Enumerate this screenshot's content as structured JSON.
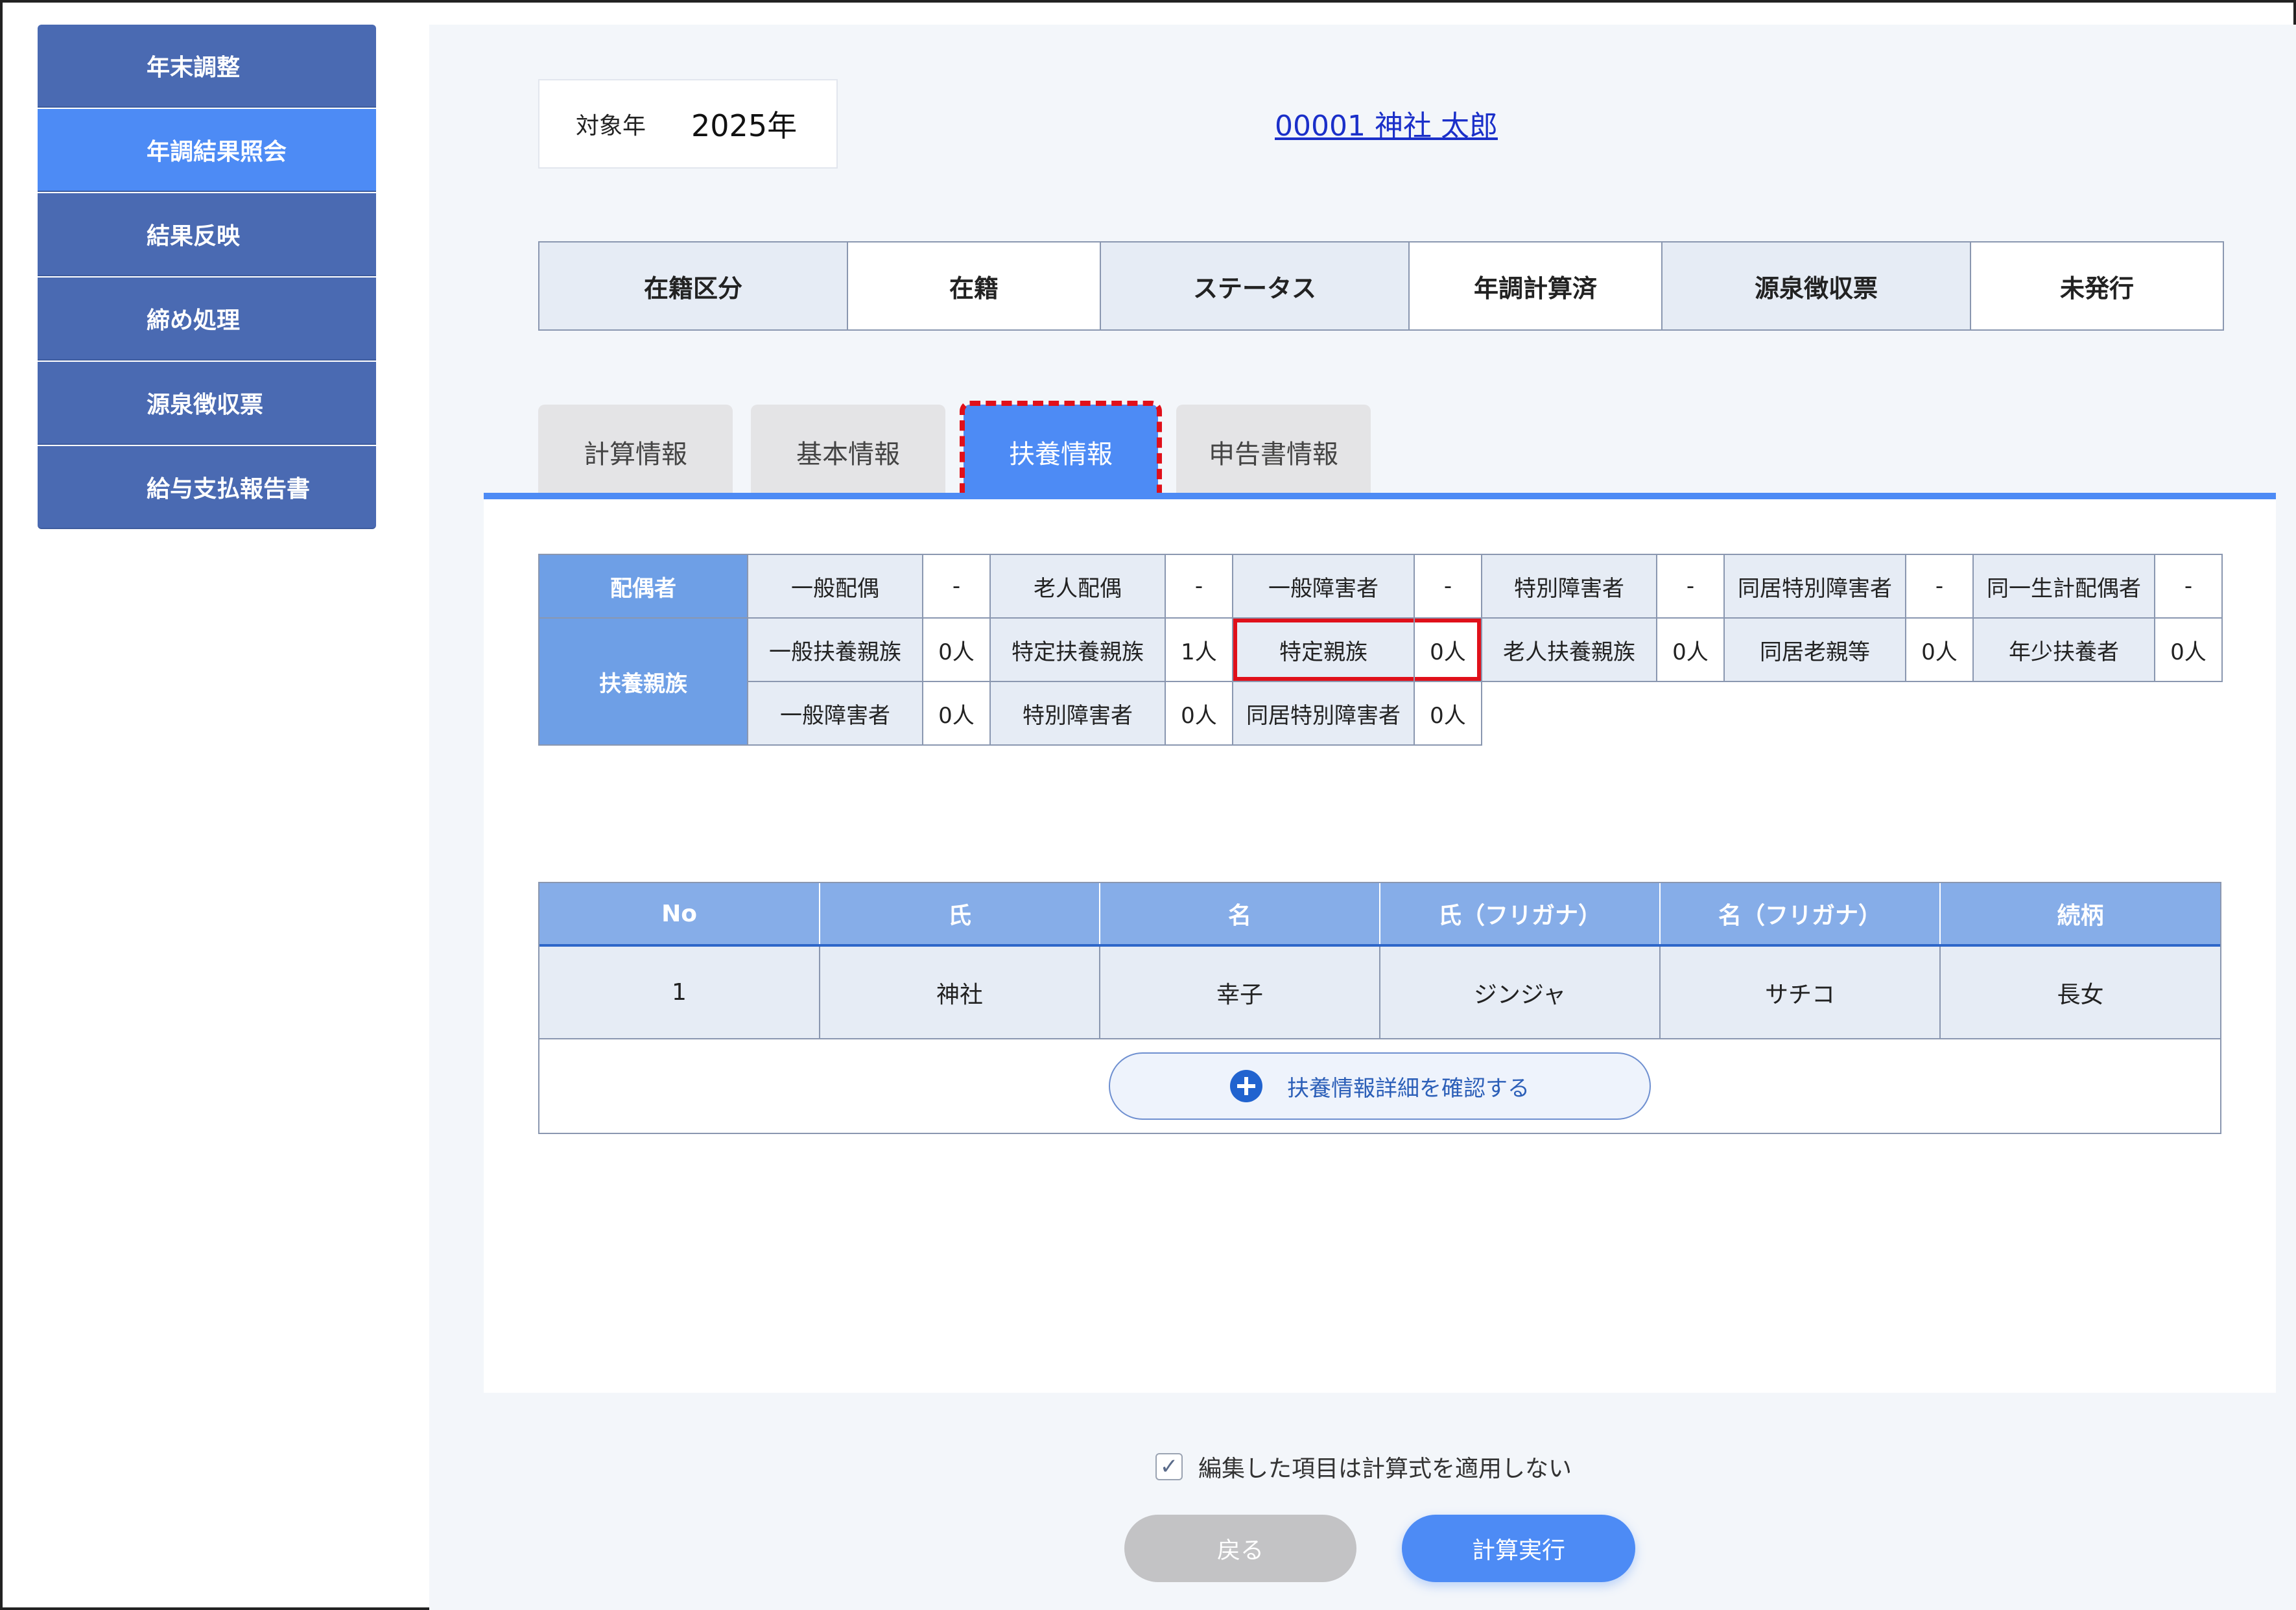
{
  "sidebar": {
    "items": [
      {
        "label": "年末調整"
      },
      {
        "label": "年調結果照会"
      },
      {
        "label": "結果反映"
      },
      {
        "label": "締め処理"
      },
      {
        "label": "源泉徴収票"
      },
      {
        "label": "給与支払報告書"
      }
    ]
  },
  "header": {
    "year_label": "対象年",
    "year_value": "2025年",
    "employee": "00001 神社 太郎"
  },
  "status": {
    "enroll_label": "在籍区分",
    "enroll_value": "在籍",
    "status_label": "ステータス",
    "status_value": "年調計算済",
    "withholding_label": "源泉徴収票",
    "withholding_value": "未発行"
  },
  "tabs": [
    {
      "label": "計算情報"
    },
    {
      "label": "基本情報"
    },
    {
      "label": "扶養情報"
    },
    {
      "label": "申告書情報"
    }
  ],
  "dependents": {
    "spouse_head": "配偶者",
    "family_head": "扶養親族",
    "spouse_row": [
      {
        "label": "一般配偶",
        "value": "-"
      },
      {
        "label": "老人配偶",
        "value": "-"
      },
      {
        "label": "一般障害者",
        "value": "-"
      },
      {
        "label": "特別障害者",
        "value": "-"
      },
      {
        "label": "同居特別障害者",
        "value": "-"
      },
      {
        "label": "同一生計配偶者",
        "value": "-"
      }
    ],
    "family_row1": [
      {
        "label": "一般扶養親族",
        "value": "0人"
      },
      {
        "label": "特定扶養親族",
        "value": "1人"
      },
      {
        "label": "特定親族",
        "value": "0人"
      },
      {
        "label": "老人扶養親族",
        "value": "0人"
      },
      {
        "label": "同居老親等",
        "value": "0人"
      },
      {
        "label": "年少扶養者",
        "value": "0人"
      }
    ],
    "family_row2": [
      {
        "label": "一般障害者",
        "value": "0人"
      },
      {
        "label": "特別障害者",
        "value": "0人"
      },
      {
        "label": "同居特別障害者",
        "value": "0人"
      }
    ]
  },
  "list": {
    "headers": [
      "No",
      "氏",
      "名",
      "氏（フリガナ）",
      "名（フリガナ）",
      "続柄"
    ],
    "rows": [
      [
        "1",
        "神社",
        "幸子",
        "ジンジャ",
        "サチコ",
        "長女"
      ]
    ],
    "detail_button": "扶養情報詳細を確認する"
  },
  "footer": {
    "checkbox_label": "編集した項目は計算式を適用しない",
    "checkbox_mark": "✓",
    "back_label": "戻る",
    "run_label": "計算実行"
  }
}
